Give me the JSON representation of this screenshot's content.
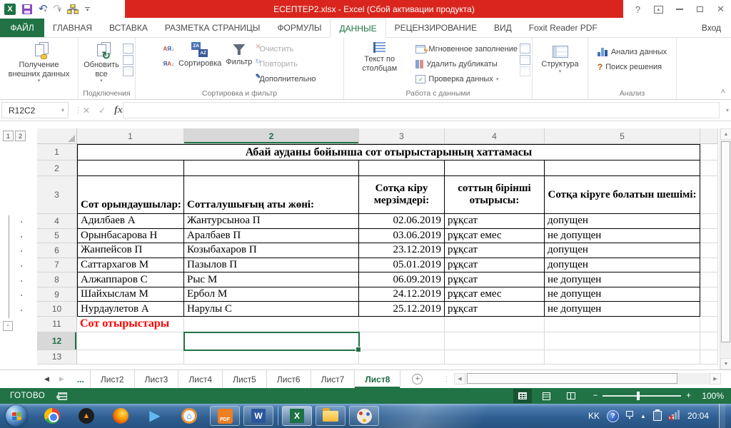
{
  "window": {
    "title": "ЕСЕПТЕР2.xlsx -  Excel (Сбой активации продукта)",
    "sign_in": "Вход"
  },
  "ribbon_tabs": {
    "file": "ФАЙЛ",
    "items": [
      "ГЛАВНАЯ",
      "ВСТАВКА",
      "РАЗМЕТКА СТРАНИЦЫ",
      "ФОРМУЛЫ",
      "ДАННЫЕ",
      "РЕЦЕНЗИРОВАНИЕ",
      "ВИД",
      "Foxit Reader PDF"
    ],
    "active": "ДАННЫЕ"
  },
  "ribbon": {
    "get_external": "Получение внешних данных",
    "refresh_all": "Обновить все",
    "connections_group": "Подключения",
    "sort": "Сортировка",
    "filter": "Фильтр",
    "clear": "Очистить",
    "reapply": "Повторить",
    "advanced": "Дополнительно",
    "sort_filter_group": "Сортировка и фильтр",
    "text_to_columns": "Текст по столбцам",
    "flash_fill": "Мгновенное заполнение",
    "remove_duplicates": "Удалить дубликаты",
    "data_validation": "Проверка данных",
    "data_tools_group": "Работа с данными",
    "outline_button": "Структура",
    "data_analysis": "Анализ данных",
    "solver": "Поиск решения",
    "analysis_group": "Анализ"
  },
  "formula_bar": {
    "name_box": "R12C2",
    "formula": "",
    "fx": "fx"
  },
  "outline": {
    "level1": "1",
    "level2": "2",
    "collapse": "-"
  },
  "sheet": {
    "column_headers": [
      "1",
      "2",
      "3",
      "4",
      "5"
    ],
    "selected_column": "2",
    "selected_row": "12",
    "title": "Абай ауданы бойынша сот отырыстарының хаттамасы",
    "headers": [
      "Сот орындаушылар:",
      "Сотталушығың аты жөні:",
      "Сотқа кіру мерзімдері:",
      "соттың бірінші отырысы:",
      "Сотқа кіруге болатын шешімі:"
    ],
    "rows": [
      [
        "Адилбаев А",
        "Жантурсыноа П",
        "02.06.2019",
        "рұқсат",
        "допущен"
      ],
      [
        "Орынбасарова Н",
        "Аралбаев П",
        "03.06.2019",
        "рұқсат емес",
        "не допущен"
      ],
      [
        "Жанпейсов П",
        "Козыбахаров П",
        "23.12.2019",
        "рұқсат",
        "допущен"
      ],
      [
        "Саттархагов М",
        "Пазылов П",
        "05.01.2019",
        "рұқсат",
        "допущен"
      ],
      [
        "Алжаппаров С",
        "Рыс М",
        "06.09.2019",
        "рұқсат",
        "не допущен"
      ],
      [
        "Шайхыслам М",
        "Ербол М",
        "24.12.2019",
        "рұқсат емес",
        "не допущен"
      ],
      [
        "Нурдаулетов А",
        "Нарулы С",
        "25.12.2019",
        "рұқсат",
        "не допущен"
      ]
    ],
    "note": "Сот отырыстары"
  },
  "sheet_tabs": {
    "more": "...",
    "items": [
      "Лист2",
      "Лист3",
      "Лист4",
      "Лист5",
      "Лист6",
      "Лист7",
      "Лист8"
    ],
    "active": "Лист8",
    "add": "+"
  },
  "status_bar": {
    "mode": "ГОТОВО",
    "zoom": "100%",
    "zoom_minus": "−",
    "zoom_plus": "+"
  },
  "taskbar": {
    "language": "KK",
    "time": "20:04",
    "pdf_label": "PDF",
    "word_label": "W",
    "excel_label": "X",
    "aimp_label": "▲",
    "play_label": "▶",
    "home_label": "⌂"
  },
  "icons": {
    "undo": "↶",
    "redo": "↷",
    "dropdown": "▾",
    "refresh": "↻",
    "help": "?",
    "close": "✕",
    "collapse": "˄",
    "cancel": "✕",
    "enter": "✓",
    "dots": "⋮",
    "nav_left": "◀",
    "nav_right": "▶",
    "scroll_up": "▲",
    "scroll_down": "▼",
    "scroll_left": "◀",
    "scroll_right": "▶",
    "hidden": "▲",
    "sort_asc": "АЯ↓",
    "sort_desc": "ЯА↓",
    "za": "ZA",
    "az": "AZ",
    "flash": "ϟ",
    "pencil": "✎",
    "check": "✓",
    "question": "?",
    "excel_logo": "X"
  },
  "colors": {
    "excel_green": "#217346",
    "title_red": "#D9251D",
    "selection_green": "#217346",
    "note_red": "#FF0000"
  }
}
